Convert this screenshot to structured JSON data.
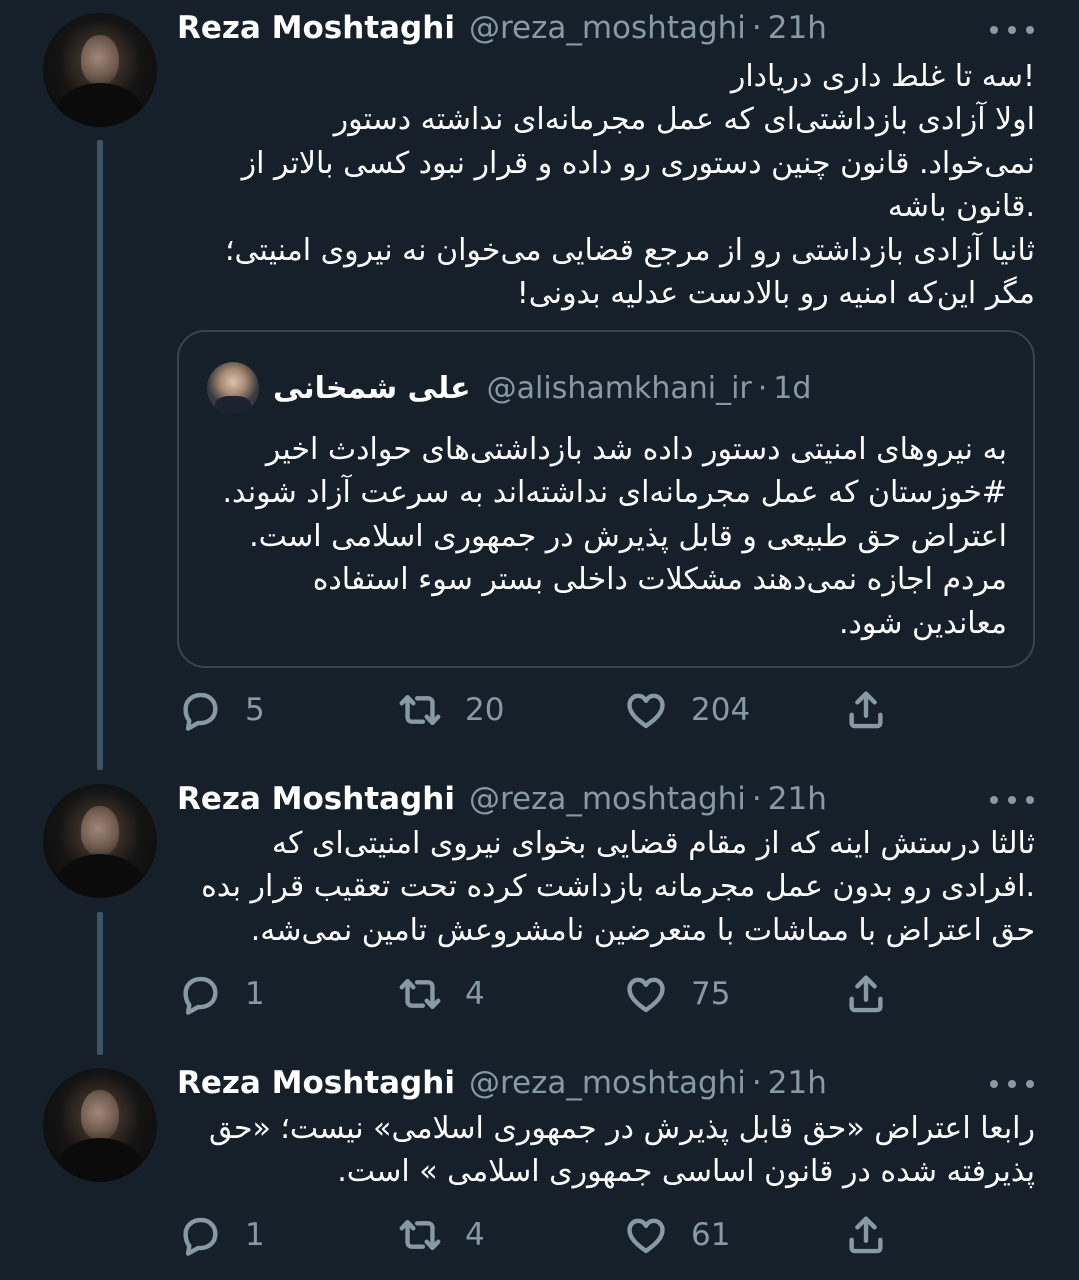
{
  "tweets": [
    {
      "name": "Reza Moshtaghi",
      "handle": "@reza_moshtaghi",
      "separator": "·",
      "time": "21h",
      "lines": [
        "!سه تا غلط داری دریادار",
        "اولا آزادی بازداشتی‌ای که عمل مجرمانه‌ای نداشته دستور",
        "نمی‌خواد. قانون چنین دستوری رو داده و قرار نبود کسی بالاتر از",
        ".قانون باشه",
        "ثانیا آزادی بازداشتی رو از مرجع قضایی می‌خوان نه نیروی امنیتی؛",
        "مگر این‌که امنیه رو بالادست عدلیه بدونی!"
      ],
      "quote": {
        "name": "علی شمخانی",
        "handle": "@alishamkhani_ir",
        "separator": "·",
        "time": "1d",
        "lines": [
          "به نیروهای امنیتی دستور داده شد بازداشتی‌های حوادث اخیر",
          "#خوزستان که عمل مجرمانه‌ای نداشته‌اند به سرعت آزاد شوند.",
          "اعتراض حق طبیعی و قابل پذیرش در جمهوری اسلامی است.",
          "مردم اجازه نمی‌دهند مشکلات داخلی بستر سوء استفاده",
          "معاندین شود."
        ]
      },
      "replies": "5",
      "retweets": "20",
      "likes": "204"
    },
    {
      "name": "Reza Moshtaghi",
      "handle": "@reza_moshtaghi",
      "separator": "·",
      "time": "21h",
      "lines": [
        "ثالثا درستش اینه که از مقام قضایی بخوای نیروی امنیتی‌ای که",
        ".افرادی رو بدون عمل مجرمانه بازداشت کرده تحت تعقیب قرار بده",
        "حق اعتراض با مماشات با متعرضین نامشروعش تامین نمی‌شه."
      ],
      "replies": "1",
      "retweets": "4",
      "likes": "75"
    },
    {
      "name": "Reza Moshtaghi",
      "handle": "@reza_moshtaghi",
      "separator": "·",
      "time": "21h",
      "lines": [
        "رابعا اعتراض «حق قابل پذیرش در جمهوری اسلامی» نیست؛ «حق",
        "پذیرفته شده در قانون اساسی جمهوری اسلامی » است."
      ],
      "replies": "1",
      "retweets": "4",
      "likes": "61"
    }
  ],
  "icons": {
    "reply": "reply-icon",
    "retweet": "retweet-icon",
    "like": "heart-icon",
    "share": "share-icon",
    "more": "more-icon"
  },
  "colors": {
    "background": "#15202b",
    "secondary_text": "#8899a6",
    "border": "#38444d",
    "thread_line": "#3d5466"
  }
}
